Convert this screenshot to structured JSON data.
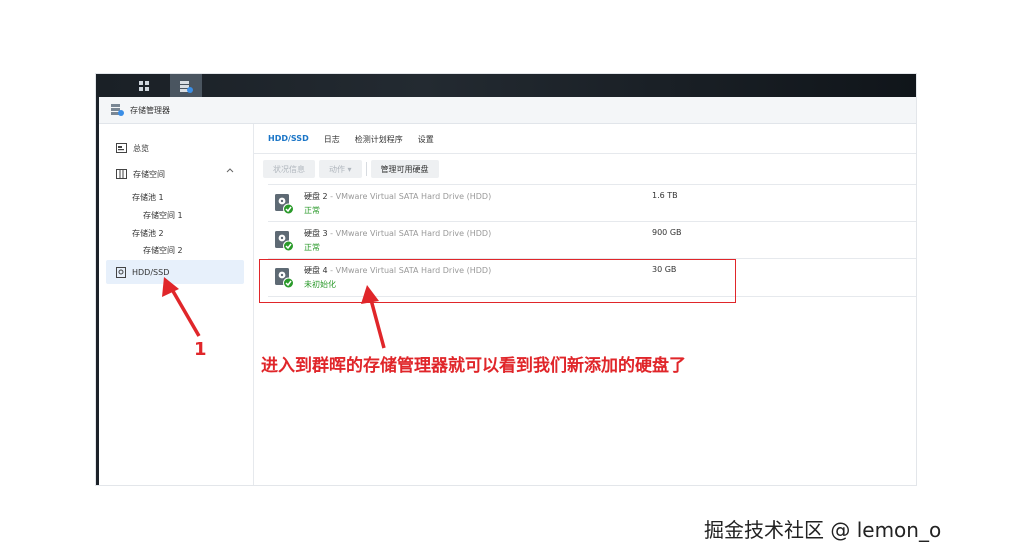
{
  "window": {
    "title": "存储管理器"
  },
  "sidebar": {
    "items": [
      {
        "label": "总览",
        "icon": "overview-icon"
      },
      {
        "label": "存储空间",
        "icon": "storage-icon"
      },
      {
        "label": "HDD/SSD",
        "icon": "disk-icon"
      }
    ],
    "subitems": [
      {
        "label": "存储池 1"
      },
      {
        "label": "存储空间 1"
      },
      {
        "label": "存储池 2"
      },
      {
        "label": "存储空间 2"
      }
    ]
  },
  "tabs": [
    {
      "label": "HDD/SSD"
    },
    {
      "label": "日志"
    },
    {
      "label": "检测计划程序"
    },
    {
      "label": "设置"
    }
  ],
  "toolbar": {
    "status_label": "状况信息",
    "action_label": "动作 ▾",
    "manage_label": "管理可用硬盘"
  },
  "disks": [
    {
      "name": "硬盘 2",
      "model": " - VMware Virtual SATA Hard Drive (HDD)",
      "status": "正常",
      "size": "1.6 TB"
    },
    {
      "name": "硬盘 3",
      "model": " - VMware Virtual SATA Hard Drive (HDD)",
      "status": "正常",
      "size": "900 GB"
    },
    {
      "name": "硬盘 4",
      "model": " - VMware Virtual SATA Hard Drive (HDD)",
      "status": "未初始化",
      "size": "30 GB"
    }
  ],
  "annotation": {
    "text": "进入到群晖的存储管理器就可以看到我们新添加的硬盘了",
    "number": "1"
  },
  "watermark": "掘金技术社区 @ lemon_o",
  "colors": {
    "accent": "#1a75c7",
    "ok": "#2a9a2a",
    "annotation": "#e0262a"
  }
}
